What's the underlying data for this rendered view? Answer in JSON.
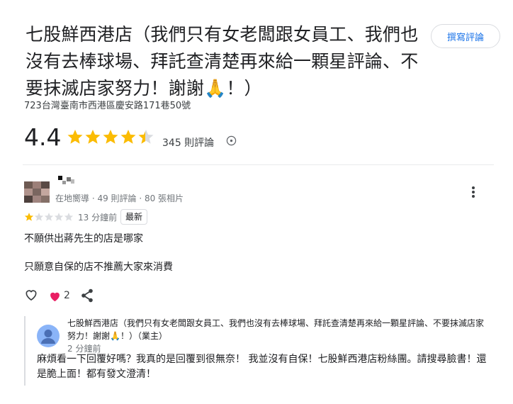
{
  "place": {
    "title": "七股鮮西港店（我們只有女老闆跟女員工、我們也沒有去棒球場、拜託查清楚再來給一顆星評論、不要抹滅店家努力！謝謝🙏！）",
    "address": "723台灣臺南市西港區慶安路171巷50號",
    "rating": "4.4",
    "rating_value": 4.4,
    "review_count_label": "345 則評論"
  },
  "toolbar": {
    "write_review_label": "撰寫評論"
  },
  "review": {
    "reviewer_meta": "在地嚮導 · 49 則評論 · 80 張相片",
    "stars": 1,
    "time_ago": "13 分鐘前",
    "badge": "最新",
    "lines": [
      "不願供出蔣先生的店是哪家",
      "只願意自保的店不推薦大家來消費"
    ],
    "like_count": "2"
  },
  "owner_response": {
    "name": "七股鮮西港店（我們只有女老闆跟女員工、我們也沒有去棒球場、拜託查清楚再來給一顆星評論、不要抹滅店家努力！謝謝🙏！）（業主）",
    "time_ago": "2 分鐘前",
    "reply": "麻煩看一下回覆好嗎？我真的是回覆到很無奈！ 我並沒有自保！七股鮮西港店粉絲團。請搜尋臉書！還是脆上面！都有發文澄清！"
  },
  "colors": {
    "star_gold": "#fbbc04",
    "star_gray": "#dadce0",
    "link_blue": "#1a73e8",
    "heart_pink": "#e91e63",
    "owner_avatar_blue": "#8ab4f8"
  }
}
